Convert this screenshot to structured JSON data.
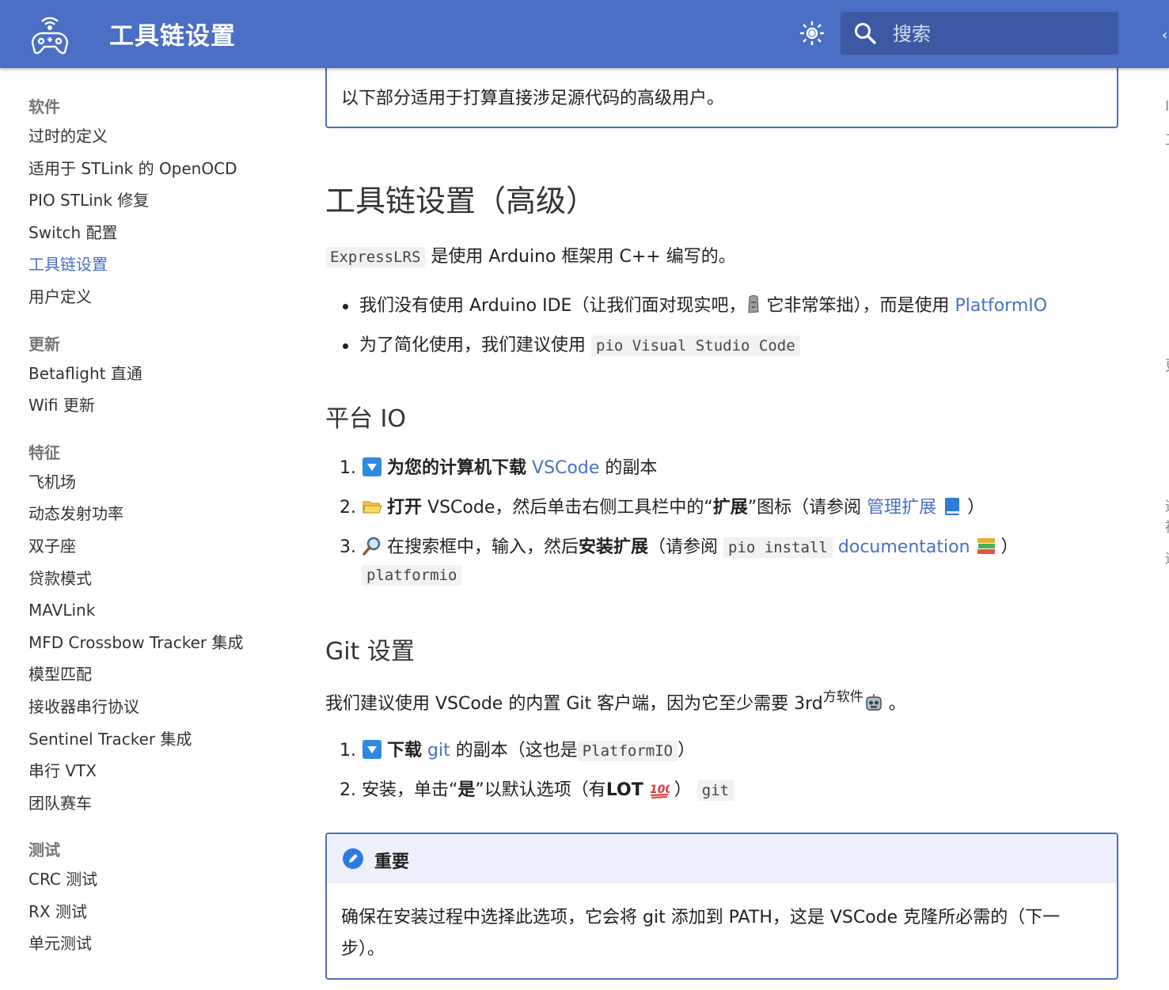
{
  "header": {
    "title": "工具链设置",
    "search_placeholder": "搜索",
    "logo_icon": "remote-controller-wifi-icon",
    "theme_icon": "brightness-icon"
  },
  "sidebar": {
    "sections": [
      {
        "title": "软件",
        "items": [
          "过时的定义",
          "适用于 STLink 的 OpenOCD",
          "PIO STLink 修复",
          "Switch 配置",
          "工具链设置",
          "用户定义"
        ]
      },
      {
        "title": "更新",
        "items": [
          "Betaflight 直通",
          "Wifi 更新"
        ]
      },
      {
        "title": "特征",
        "items": [
          "飞机场",
          "动态发射功率",
          "双子座",
          "贷款模式",
          "MAVLink",
          "MFD Crossbow Tracker 集成",
          "模型匹配",
          "接收器串行协议",
          "Sentinel Tracker 集成",
          "串行 VTX",
          "团队赛车"
        ]
      },
      {
        "title": "测试",
        "items": [
          "CRC 测试",
          "RX 测试",
          "单元测试"
        ]
      }
    ],
    "active_item": "工具链设置"
  },
  "main": {
    "note": "以下部分适用于打算直接涉足源代码的高级用户。",
    "h1": "工具链设置（高级）",
    "intro_code": "ExpressLRS",
    "intro_text": "是使用 Arduino 框架用 C++ 编写的。",
    "bullet1_text": "我们没有使用 Arduino IDE（让我们面对现实吧，",
    "bullet1_text2": "它非常笨拙），而是使用",
    "bullet1_link": "PlatformIO",
    "bullet2_text": "为了简化使用，我们建议使用",
    "bullet2_code": "pio Visual Studio Code",
    "h2_platform": "平台 IO",
    "step1_num": "1.",
    "step1_bold": "为您的计算机下载",
    "step1_link": "VSCode",
    "step1_rest": "的副本",
    "step2_num": "2.",
    "step2_bold": "打开",
    "step2_text": "VSCode，然后单击右侧工具栏中的“",
    "step2_bold2": "扩展",
    "step2_text2": "”图标（请参阅",
    "step2_link": "管理扩展",
    "step2_end": "）",
    "step3_num": "3.",
    "step3_text": "在搜索框中，输入，然后",
    "step3_bold": "安装扩展",
    "step3_text2": "（请参阅",
    "step3_code": "pio install",
    "step3_link": "documentation",
    "step3_end": "）",
    "step3_code2": "platformio",
    "h2_git": "Git 设置",
    "git_text": "我们建议使用 VSCode 的内置 Git 客户端，因为它至少需要 3rd",
    "git_sup": "方软件",
    "git_end": "。",
    "gstep1_num": "1.",
    "gstep1_bold": "下载",
    "gstep1_link": "git",
    "gstep1_text": "的副本（这也是",
    "gstep1_code": "PlatformIO",
    "gstep1_end": "）",
    "gstep2_text": "2. 安装，单击“",
    "gstep2_bold": "是",
    "gstep2_text2": "”以默认选项（有",
    "gstep2_bold2": "LOT",
    "gstep2_end": "）",
    "gstep2_code": "git",
    "important_title": "重要",
    "important_body": "确保在安装过程中选择此选项，它会将 git 添加到 PATH，这是 VSCode 克隆所必需的（下一步）。"
  },
  "right_column_glyphs": [
    "I",
    "工",
    "更",
    "适",
    "被",
    "适"
  ],
  "colors": {
    "header": "#4a6fc4",
    "link": "#4a6fc4",
    "accent": "#4a6fc4"
  }
}
